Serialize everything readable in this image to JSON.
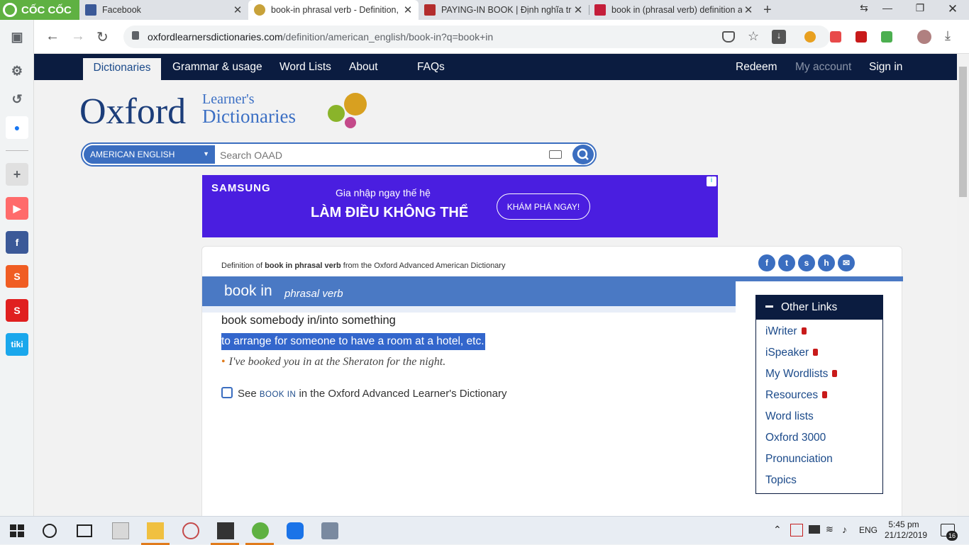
{
  "browser": {
    "brand": "CỐC CỐC",
    "tabs": [
      {
        "label": "Facebook",
        "icon": "facebook-icon",
        "color": "#3b5998"
      },
      {
        "label": "book-in phrasal verb - Definition, p",
        "icon": "oxford-icon",
        "color": "#c8a23a"
      },
      {
        "label": "PAYING-IN BOOK | Định nghĩa trong",
        "icon": "cambridge-icon",
        "color": "#b32d2d"
      },
      {
        "label": "book in (phrasal verb) definition an",
        "icon": "macmillan-icon",
        "color": "#c41e3a"
      }
    ],
    "url_host": "oxfordlearnersdictionaries.com",
    "url_path": "/definition/american_english/book-in?q=book+in"
  },
  "site": {
    "nav": [
      "Dictionaries",
      "Grammar & usage",
      "Word Lists",
      "About",
      "FAQs"
    ],
    "account": [
      "Redeem",
      "My account",
      "Sign in"
    ],
    "logo_main": "Oxford",
    "logo_sub1": "Learner's",
    "logo_sub2": "Dictionaries",
    "search_lang": "AMERICAN ENGLISH",
    "search_placeholder": "Search OAAD"
  },
  "ad": {
    "brand": "SAMSUNG",
    "line1": "Gia nhập ngay thế hệ",
    "line2": "LÀM ĐIỀU KHÔNG THỂ",
    "cta": "KHÁM PHÁ NGAY!",
    "info": "i"
  },
  "entry": {
    "label_pre": "Definition of ",
    "label_bold": "book in phrasal verb",
    "label_post": " from the Oxford Advanced American Dictionary",
    "headword": "book in",
    "pos": "phrasal verb",
    "phrase": "book somebody in/into something",
    "definition": "to arrange for someone to have a room at a hotel, etc.",
    "example": "I've booked you in at the Sheraton for the night.",
    "see_pre": "See ",
    "see_link": "BOOK IN",
    "see_post": " in the Oxford Advanced Learner's Dictionary"
  },
  "social": [
    "f",
    "t",
    "s",
    "h",
    "✉"
  ],
  "other_links": {
    "title": "Other Links",
    "items": [
      {
        "label": "iWriter",
        "locked": true
      },
      {
        "label": "iSpeaker",
        "locked": true
      },
      {
        "label": "My Wordlists",
        "locked": true
      },
      {
        "label": "Resources",
        "locked": true
      },
      {
        "label": "Word lists",
        "locked": false
      },
      {
        "label": "Oxford 3000",
        "locked": false
      },
      {
        "label": "Pronunciation",
        "locked": false
      },
      {
        "label": "Topics",
        "locked": false
      }
    ]
  },
  "taskbar": {
    "lang": "ENG",
    "time": "5:45 pm",
    "date": "21/12/2019",
    "notifications": "16"
  },
  "colors": {
    "navy": "#0b1c40",
    "oxford_blue": "#3b6ec0",
    "highlight": "#3366cc",
    "coccoc_green": "#5fb142"
  }
}
